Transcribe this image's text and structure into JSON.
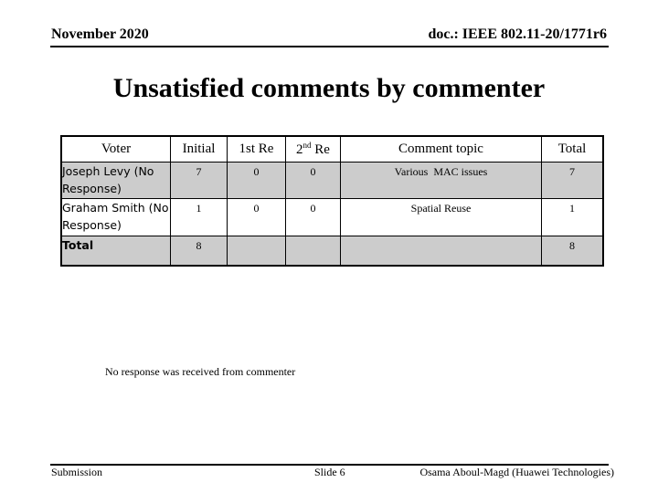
{
  "header": {
    "date": "November 2020",
    "doc_id": "doc.: IEEE 802.11-20/1771r6"
  },
  "title": "Unsatisfied comments by commenter",
  "table": {
    "headers": {
      "voter": "Voter",
      "initial": "Initial",
      "first_re": "1st Re",
      "second_re_num": "2",
      "second_re_sup": "nd",
      "second_re_label": " Re",
      "topic": "Comment topic",
      "total": "Total"
    },
    "rows": [
      {
        "voter": "Joseph Levy (No Response)",
        "initial": "7",
        "first_re": "0",
        "second_re": "0",
        "topic": "Various  MAC issues",
        "total": "7"
      },
      {
        "voter": "Graham Smith (No Response)",
        "initial": "1",
        "first_re": "0",
        "second_re": "0",
        "topic": "Spatial Reuse",
        "total": "1"
      },
      {
        "voter": "Total",
        "initial": "8",
        "first_re": "",
        "second_re": "",
        "topic": "",
        "total": "8"
      }
    ]
  },
  "caption": "No response was received from commenter",
  "footer": {
    "left": "Submission",
    "slide": "Slide 6",
    "author": "Osama Aboul-Magd (Huawei Technologies)"
  }
}
